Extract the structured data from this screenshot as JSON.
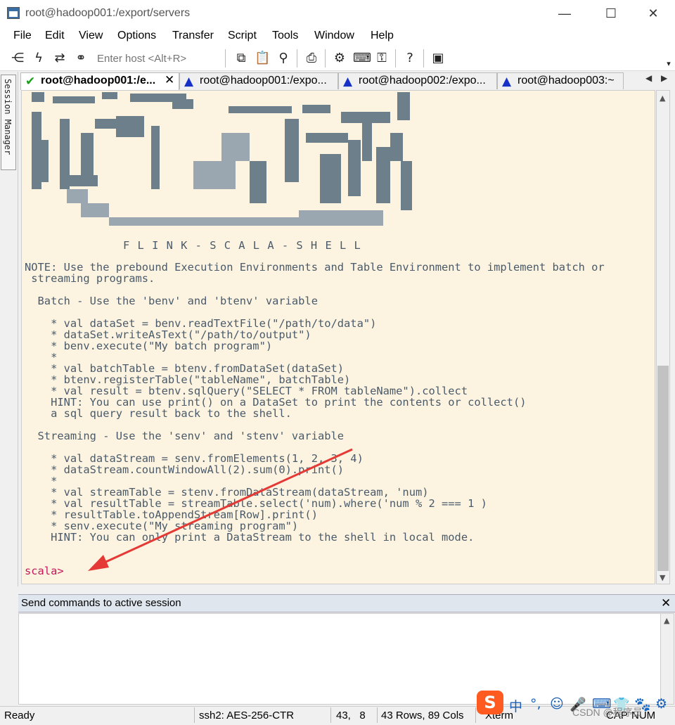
{
  "window": {
    "title": "root@hadoop001:/export/servers",
    "minimize": "—",
    "maximize": "☐",
    "close": "✕"
  },
  "menu": [
    "File",
    "Edit",
    "View",
    "Options",
    "Transfer",
    "Script",
    "Tools",
    "Window",
    "Help"
  ],
  "toolbar": {
    "host_placeholder": "Enter host <Alt+R>",
    "icons": [
      "connect-icon",
      "lightning-icon",
      "reconnect-icon",
      "disconnect-icon",
      "copy-icon",
      "paste-icon",
      "find-icon",
      "print-icon",
      "settings-icon",
      "keymap-icon",
      "sftp-icon",
      "help-icon",
      "app-icon"
    ]
  },
  "session_manager": {
    "label": "Session Manager"
  },
  "tabs": [
    {
      "label": "root@hadoop001:/e...",
      "status": "connected"
    },
    {
      "label": "root@hadoop001:/expo...",
      "status": "warning"
    },
    {
      "label": "root@hadoop002:/expo...",
      "status": "warning"
    },
    {
      "label": "root@hadoop003:~",
      "status": "warning"
    }
  ],
  "terminal": {
    "banner": "F L I N K - S C A L A - S H E L L",
    "lines": [
      "NOTE: Use the prebound Execution Environments and Table Environment to implement batch or",
      " streaming programs.",
      "",
      "  Batch - Use the 'benv' and 'btenv' variable",
      "",
      "    * val dataSet = benv.readTextFile(\"/path/to/data\")",
      "    * dataSet.writeAsText(\"/path/to/output\")",
      "    * benv.execute(\"My batch program\")",
      "    *",
      "    * val batchTable = btenv.fromDataSet(dataSet)",
      "    * btenv.registerTable(\"tableName\", batchTable)",
      "    * val result = btenv.sqlQuery(\"SELECT * FROM tableName\").collect",
      "    HINT: You can use print() on a DataSet to print the contents or collect()",
      "    a sql query result back to the shell.",
      "",
      "  Streaming - Use the 'senv' and 'stenv' variable",
      "",
      "    * val dataStream = senv.fromElements(1, 2, 3, 4)",
      "    * dataStream.countWindowAll(2).sum(0).print()",
      "    *",
      "    * val streamTable = stenv.fromDataStream(dataStream, 'num)",
      "    * val resultTable = streamTable.select('num).where('num % 2 === 1 )",
      "    * resultTable.toAppendStream[Row].print()",
      "    * senv.execute(\"My streaming program\")",
      "    HINT: You can only print a DataStream to the shell in local mode."
    ],
    "prompt": "scala>",
    "prompt_color": "#c2185b"
  },
  "send_commands": {
    "title": "Send commands to active session",
    "close": "✕"
  },
  "status": {
    "ready": "Ready",
    "cipher": "ssh2: AES-256-CTR",
    "cursor": "43,   8",
    "size": "43 Rows, 89 Cols",
    "term": "Xterm",
    "caps": "CAP",
    "num": "NUM"
  },
  "ime": {
    "logo": "S",
    "items": [
      "中",
      "°,",
      "☺",
      "🎤",
      "⌨",
      "👕",
      "🐾",
      "⚙"
    ]
  },
  "watermark": "CSDN @程序员"
}
